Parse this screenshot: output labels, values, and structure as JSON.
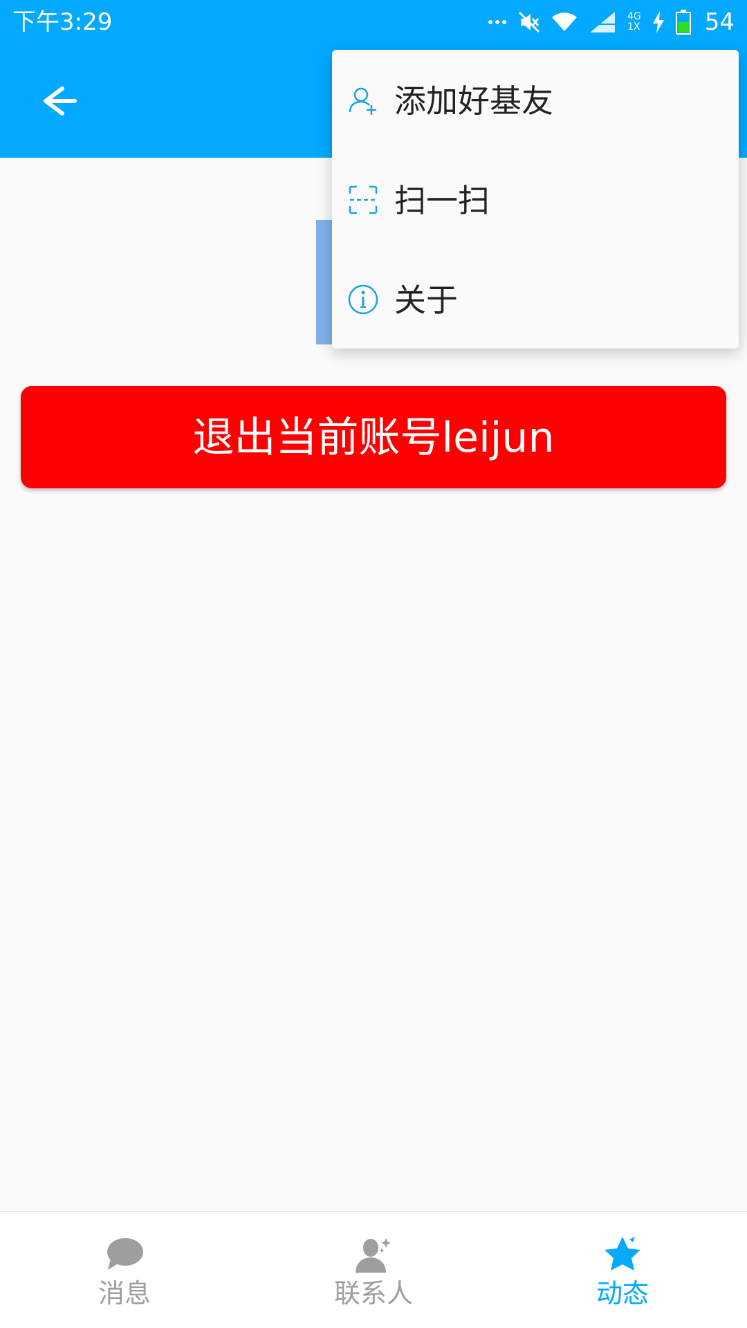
{
  "status_bar": {
    "time": "下午3:29",
    "network": "4G",
    "network_sub": "1X",
    "battery": "54",
    "icons": [
      "more-dots-icon",
      "mute-icon",
      "wifi-icon",
      "signal-icon",
      "charging-icon",
      "battery-icon"
    ]
  },
  "toolbar": {
    "back_icon": "arrow-left-icon",
    "color": "#02a9ff"
  },
  "menu": {
    "items": [
      {
        "label": "添加好基友",
        "icon": "add-friend-icon"
      },
      {
        "label": "扫一扫",
        "icon": "scan-icon"
      },
      {
        "label": "关于",
        "icon": "info-icon"
      }
    ]
  },
  "main": {
    "logout_label": "退出当前账号leijun",
    "logout_color": "#ff0000"
  },
  "bottom_nav": {
    "items": [
      {
        "label": "消息",
        "icon": "message-bubble-icon",
        "active": false
      },
      {
        "label": "联系人",
        "icon": "contact-person-icon",
        "active": false
      },
      {
        "label": "动态",
        "icon": "star-icon",
        "active": true
      }
    ],
    "active_color": "#02a9ff",
    "inactive_color": "#9e9e9e"
  }
}
